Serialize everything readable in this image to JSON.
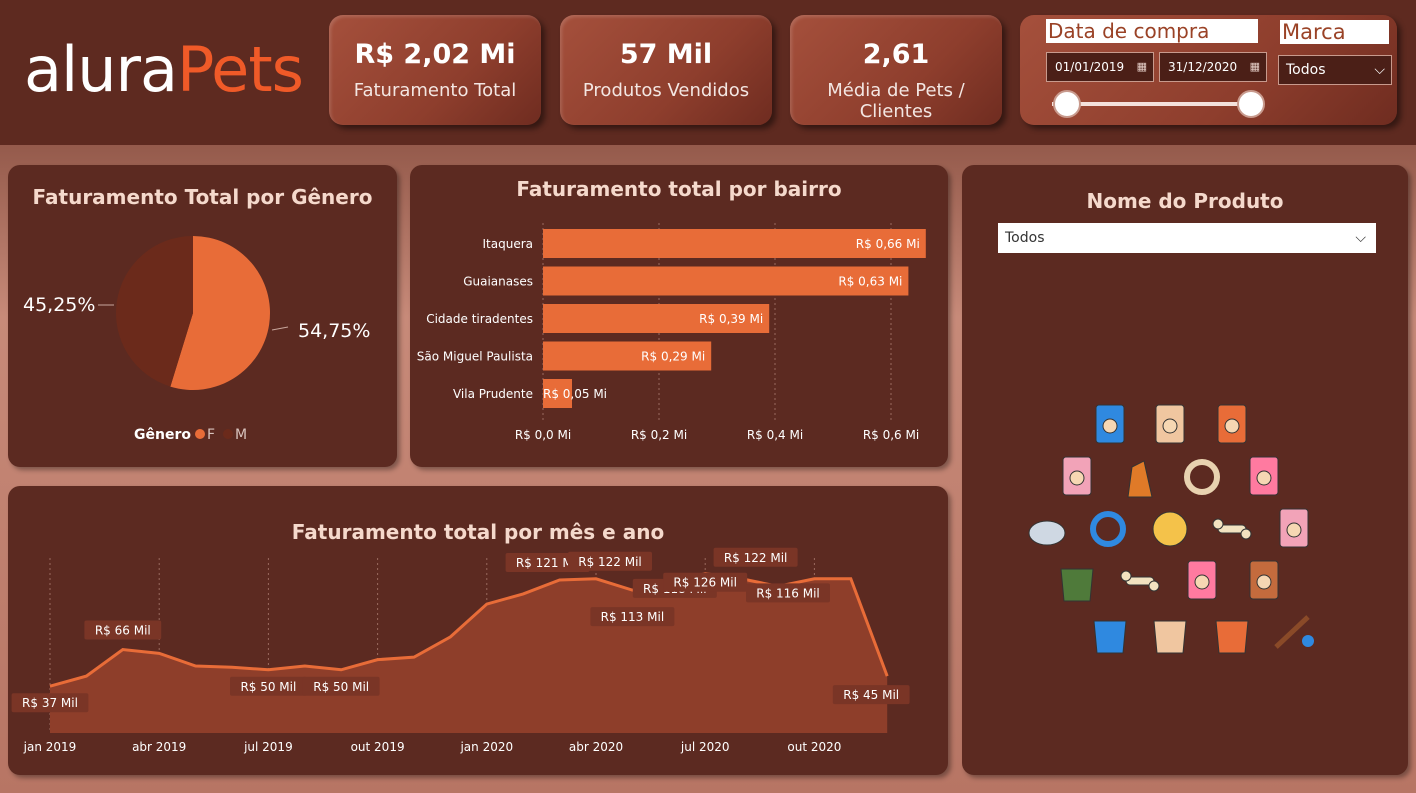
{
  "logo": {
    "part1": "alura",
    "part2": "Pets"
  },
  "kpis": [
    {
      "value": "R$ 2,02 Mi",
      "label": "Faturamento Total"
    },
    {
      "value": "57 Mil",
      "label": "Produtos Vendidos"
    },
    {
      "value": "2,61",
      "label": "Média de Pets / Clientes"
    }
  ],
  "filters": {
    "date_title": "Data de compra",
    "date_start": "01/01/2019",
    "date_end": "31/12/2020",
    "brand_title": "Marca",
    "brand_value": "Todos"
  },
  "gender_panel": {
    "title": "Faturamento Total por Gênero",
    "legend_title": "Gênero",
    "colors": {
      "F": "#e86c38",
      "M": "#6b2a1b"
    }
  },
  "bairro_panel": {
    "title": "Faturamento total por bairro"
  },
  "month_panel": {
    "title": "Faturamento total por mês e ano"
  },
  "product_panel": {
    "title": "Nome do Produto",
    "dropdown_value": "Todos"
  },
  "product_icons": [
    "dog-food-bag-blue-icon",
    "dog-food-bag-blue-icon",
    "pet-food-bag-bone-icon",
    "pet-food-bag-bone-icon",
    "dog-figure-icon",
    "pet-collar-tag-icon",
    "dog-food-bag-blue-icon",
    "toy-mouse-icon",
    "dog-collar-icon",
    "spiky-ball-icon",
    "bone-snack-pack-icon",
    "pet-food-bag-bone-icon",
    "pet-coat-icon",
    "bone-toy-icon",
    "treat-bag-icon",
    "canned-food-icon",
    "pet-coat-icon",
    "pet-clothes-hanger-icon",
    "pet-clothes-hanger-icon",
    "leash-icon"
  ],
  "chart_data": [
    {
      "type": "pie",
      "title": "Faturamento Total por Gênero",
      "categories": [
        "F",
        "M"
      ],
      "values": [
        54.75,
        45.25
      ],
      "labels": [
        "54,75%",
        "45,25%"
      ],
      "legend_title": "Gênero",
      "legend": "bottom"
    },
    {
      "type": "bar",
      "orientation": "horizontal",
      "title": "Faturamento total por bairro",
      "categories": [
        "Itaquera",
        "Guaianases",
        "Cidade tiradentes",
        "São Miguel Paulista",
        "Vila Prudente"
      ],
      "values": [
        0.66,
        0.63,
        0.39,
        0.29,
        0.05
      ],
      "data_labels": [
        "R$ 0,66 Mi",
        "R$ 0,63 Mi",
        "R$ 0,39 Mi",
        "R$ 0,29 Mi",
        "R$ 0,05 Mi"
      ],
      "xticks": [
        0,
        0.2,
        0.4,
        0.6
      ],
      "xtick_labels": [
        "R$ 0,0 Mi",
        "R$ 0,2 Mi",
        "R$ 0,4 Mi",
        "R$ 0,6 Mi"
      ],
      "xlim": [
        0,
        0.68
      ],
      "color": "#e86c38"
    },
    {
      "type": "area",
      "title": "Faturamento total por mês e ano",
      "x": [
        "2019-01",
        "2019-02",
        "2019-03",
        "2019-04",
        "2019-05",
        "2019-06",
        "2019-07",
        "2019-08",
        "2019-09",
        "2019-10",
        "2019-11",
        "2019-12",
        "2020-01",
        "2020-02",
        "2020-03",
        "2020-04",
        "2020-05",
        "2020-06",
        "2020-07",
        "2020-08",
        "2020-09",
        "2020-10",
        "2020-11",
        "2020-12"
      ],
      "values": [
        37,
        45,
        66,
        63,
        53,
        52,
        50,
        53,
        50,
        58,
        60,
        76,
        102,
        110,
        121,
        122,
        113,
        118,
        126,
        122,
        116,
        122,
        122,
        45
      ],
      "data_labels": [
        {
          "index": 0,
          "text": "R$ 37 Mil"
        },
        {
          "index": 2,
          "text": "R$ 66 Mil"
        },
        {
          "index": 6,
          "text": "R$ 50 Mil"
        },
        {
          "index": 8,
          "text": "R$ 50 Mil"
        },
        {
          "index": 14,
          "text": "R$ 121 Mil"
        },
        {
          "index": 15,
          "text": "R$ 122 Mil"
        },
        {
          "index": 16,
          "text": "R$ 113 Mil"
        },
        {
          "index": 17,
          "text": "R$ 118 Mil"
        },
        {
          "index": 18,
          "text": "R$ 126 Mil"
        },
        {
          "index": 19,
          "text": "R$ 122 Mil"
        },
        {
          "index": 20,
          "text": "R$ 116 Mil"
        },
        {
          "index": 23,
          "text": "R$ 45 Mil"
        }
      ],
      "xtick_labels": [
        {
          "index": 0,
          "text": "jan 2019"
        },
        {
          "index": 3,
          "text": "abr 2019"
        },
        {
          "index": 6,
          "text": "jul 2019"
        },
        {
          "index": 9,
          "text": "out 2019"
        },
        {
          "index": 12,
          "text": "jan 2020"
        },
        {
          "index": 15,
          "text": "abr 2020"
        },
        {
          "index": 18,
          "text": "jul 2020"
        },
        {
          "index": 21,
          "text": "out 2020"
        }
      ],
      "ylim": [
        0,
        140
      ],
      "line_color": "#e86c38",
      "fill_color": "#8e3e2a"
    }
  ]
}
